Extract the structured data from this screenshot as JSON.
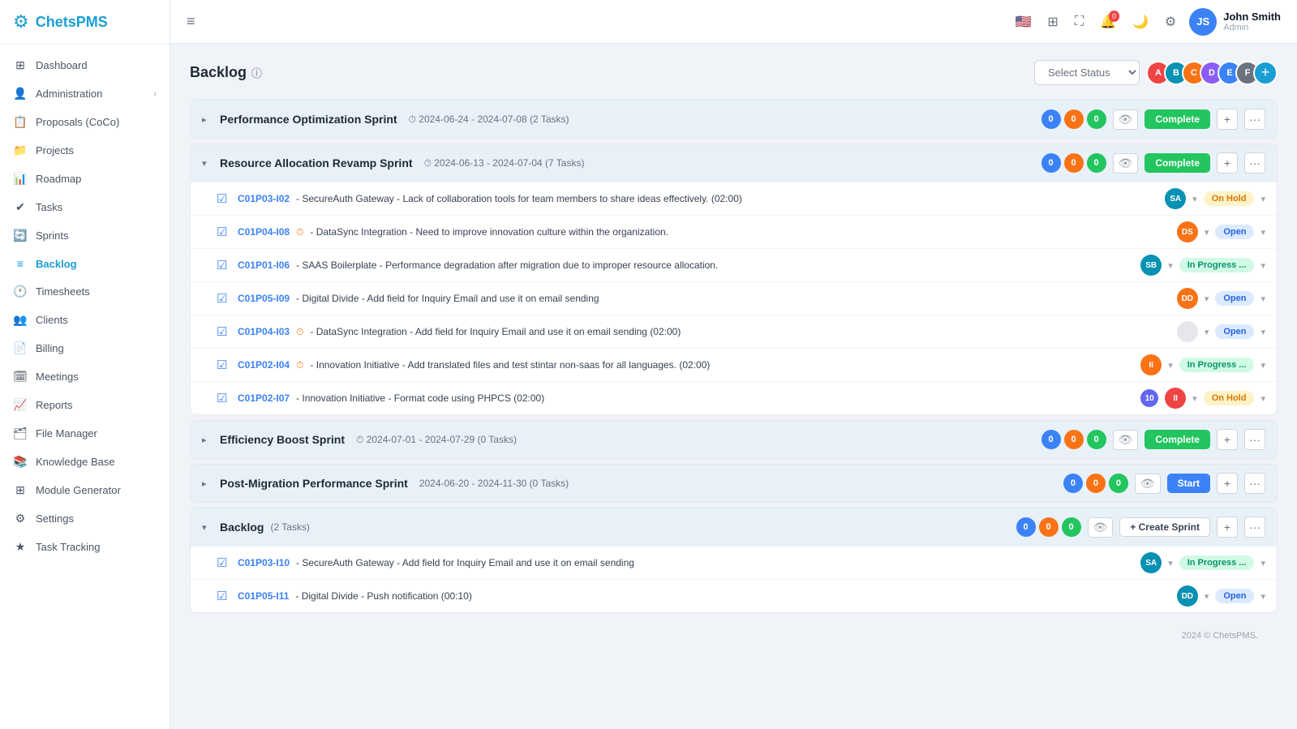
{
  "app": {
    "name": "ChetsPMS",
    "logo_symbol": "⚙"
  },
  "header": {
    "hamburger": "≡",
    "user": {
      "name": "John Smith",
      "role": "Admin",
      "initials": "JS"
    }
  },
  "sidebar": {
    "items": [
      {
        "id": "dashboard",
        "label": "Dashboard",
        "icon": "⊞"
      },
      {
        "id": "administration",
        "label": "Administration",
        "icon": "👤",
        "arrow": "›"
      },
      {
        "id": "proposals",
        "label": "Proposals (CoCo)",
        "icon": "📋"
      },
      {
        "id": "projects",
        "label": "Projects",
        "icon": "📁"
      },
      {
        "id": "roadmap",
        "label": "Roadmap",
        "icon": "📊"
      },
      {
        "id": "tasks",
        "label": "Tasks",
        "icon": "✔"
      },
      {
        "id": "sprints",
        "label": "Sprints",
        "icon": "🔄"
      },
      {
        "id": "backlog",
        "label": "Backlog",
        "icon": "≡",
        "active": true
      },
      {
        "id": "timesheets",
        "label": "Timesheets",
        "icon": "🕐"
      },
      {
        "id": "clients",
        "label": "Clients",
        "icon": "👥"
      },
      {
        "id": "billing",
        "label": "Billing",
        "icon": "📄"
      },
      {
        "id": "meetings",
        "label": "Meetings",
        "icon": "🗓"
      },
      {
        "id": "reports",
        "label": "Reports",
        "icon": "📈"
      },
      {
        "id": "file-manager",
        "label": "File Manager",
        "icon": "🗂"
      },
      {
        "id": "knowledge-base",
        "label": "Knowledge Base",
        "icon": "📚"
      },
      {
        "id": "module-generator",
        "label": "Module Generator",
        "icon": "⊞"
      },
      {
        "id": "settings",
        "label": "Settings",
        "icon": "⚙"
      },
      {
        "id": "task-tracking",
        "label": "Task Tracking",
        "icon": "★"
      }
    ],
    "footer": "2024 © ChetsPMS."
  },
  "page": {
    "title": "Backlog",
    "info_icon": "ⓘ"
  },
  "controls": {
    "select_status_placeholder": "Select Status",
    "add_member_icon": "+"
  },
  "sprints": [
    {
      "id": "sprint1",
      "name": "Performance Optimization Sprint",
      "icon": "⏱",
      "dates": "2024-06-24 - 2024-07-08",
      "tasks_count": "2 Tasks",
      "badges": [
        0,
        0,
        0
      ],
      "action_btn": "Complete",
      "action_type": "complete",
      "expanded": false,
      "tasks": []
    },
    {
      "id": "sprint2",
      "name": "Resource Allocation Revamp Sprint",
      "icon": "⏱",
      "dates": "2024-06-13 - 2024-07-04",
      "tasks_count": "7 Tasks",
      "badges": [
        0,
        0,
        0
      ],
      "action_btn": "Complete",
      "action_type": "complete",
      "expanded": true,
      "tasks": [
        {
          "id": "C01P03-I02",
          "icon": "",
          "desc": "SecureAuth Gateway - Lack of collaboration tools for team members to share ideas effectively. (02:00)",
          "status": "On Hold",
          "status_type": "onhold",
          "avatar_color": "av-teal",
          "avatar_initials": "SA"
        },
        {
          "id": "C01P04-I08",
          "icon": "⏱",
          "desc": "DataSync Integration - Need to improve innovation culture within the organization.",
          "status": "Open",
          "status_type": "open",
          "avatar_color": "av-orange",
          "avatar_initials": "DS"
        },
        {
          "id": "C01P01-I06",
          "icon": "",
          "desc": "SAAS Boilerplate - Performance degradation after migration due to improper resource allocation.",
          "status": "In Progress ...",
          "status_type": "inprogress",
          "avatar_color": "av-teal",
          "avatar_initials": "SB"
        },
        {
          "id": "C01P05-I09",
          "icon": "",
          "desc": "Digital Divide - Add field for Inquiry Email and use it on email sending",
          "status": "Open",
          "status_type": "open",
          "avatar_color": "av-orange",
          "avatar_initials": "DD"
        },
        {
          "id": "C01P04-I03",
          "icon": "⏱",
          "desc": "DataSync Integration - Add field for Inquiry Email and use it on email sending (02:00)",
          "status": "Open",
          "status_type": "open",
          "avatar_color": "",
          "avatar_initials": ""
        },
        {
          "id": "C01P02-I04",
          "icon": "⏱",
          "desc": "Innovation Initiative - Add translated files and test stintar non-saas for all languages. (02:00)",
          "status": "In Progress ...",
          "status_type": "inprogress",
          "avatar_color": "av-orange",
          "avatar_initials": "II"
        },
        {
          "id": "C01P02-I07",
          "icon": "",
          "desc": "Innovation Initiative - Format code using PHPCS (02:00)",
          "status": "On Hold",
          "status_type": "onhold",
          "avatar_color": "av-red",
          "avatar_initials": "II",
          "num_badge": 10
        }
      ]
    },
    {
      "id": "sprint3",
      "name": "Efficiency Boost Sprint",
      "icon": "⏱",
      "dates": "2024-07-01 - 2024-07-29",
      "tasks_count": "0 Tasks",
      "badges": [
        0,
        0,
        0
      ],
      "action_btn": "Complete",
      "action_type": "complete",
      "expanded": false,
      "tasks": []
    },
    {
      "id": "sprint4",
      "name": "Post-Migration Performance Sprint",
      "icon": "",
      "dates": "2024-06-20 - 2024-11-30",
      "tasks_count": "0 Tasks",
      "badges": [
        0,
        0,
        0
      ],
      "action_btn": "Start",
      "action_type": "start",
      "expanded": false,
      "tasks": []
    },
    {
      "id": "backlog",
      "name": "Backlog",
      "icon": "⏱",
      "dates": "",
      "tasks_count": "2 Tasks",
      "badges": [
        0,
        0,
        0
      ],
      "action_btn": "Create Sprint",
      "action_type": "create",
      "expanded": true,
      "is_backlog": true,
      "tasks": [
        {
          "id": "C01P03-I10",
          "icon": "",
          "desc": "SecureAuth Gateway - Add field for Inquiry Email and use it on email sending",
          "status": "In Progress ...",
          "status_type": "inprogress",
          "avatar_color": "av-teal",
          "avatar_initials": "SA"
        },
        {
          "id": "C01P05-I11",
          "icon": "",
          "desc": "Digital Divide - Push notification (00:10)",
          "status": "Open",
          "status_type": "open",
          "avatar_color": "av-teal",
          "avatar_initials": "DD"
        }
      ]
    }
  ],
  "avatars": [
    {
      "color": "av-red",
      "initials": "A"
    },
    {
      "color": "av-teal",
      "initials": "B"
    },
    {
      "color": "av-orange",
      "initials": "C"
    },
    {
      "color": "av-purple",
      "initials": "D"
    },
    {
      "color": "av-blue",
      "initials": "E"
    },
    {
      "color": "av-gray",
      "initials": "F"
    }
  ]
}
